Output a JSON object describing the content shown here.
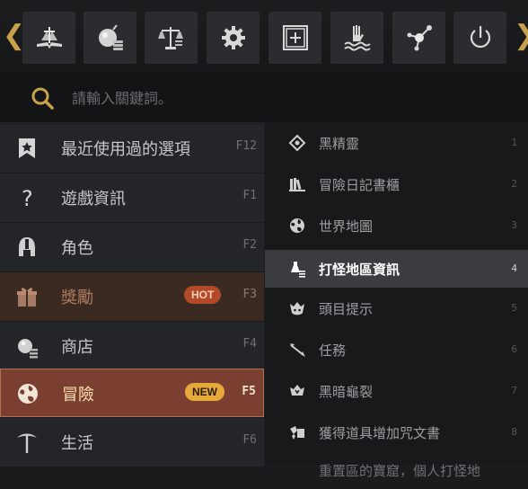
{
  "toolbar": {
    "prev_arrow": "❮",
    "next_arrow": "❯",
    "buttons": [
      {
        "name": "guide-book-icon"
      },
      {
        "name": "shop-coin-icon"
      },
      {
        "name": "balance-scale-icon"
      },
      {
        "name": "gear-icon"
      },
      {
        "name": "add-window-icon"
      },
      {
        "name": "hand-water-icon"
      },
      {
        "name": "network-nodes-icon"
      },
      {
        "name": "power-icon"
      }
    ]
  },
  "search": {
    "placeholder": "請輸入關鍵詞。"
  },
  "left_menu": {
    "items": [
      {
        "label": "最近使用過的選項",
        "key": "F12",
        "icon": "bookmark-star-icon"
      },
      {
        "label": "遊戲資訊",
        "key": "F1",
        "icon": "question-mark-icon"
      },
      {
        "label": "角色",
        "key": "F2",
        "icon": "helmet-icon"
      },
      {
        "label": "獎勵",
        "key": "F3",
        "icon": "gift-box-icon",
        "badge": "HOT"
      },
      {
        "label": "商店",
        "key": "F4",
        "icon": "shop-coin-icon"
      },
      {
        "label": "冒險",
        "key": "F5",
        "icon": "globe-icon",
        "badge": "NEW",
        "active": true
      },
      {
        "label": "生活",
        "key": "F6",
        "icon": "pickaxe-icon"
      }
    ]
  },
  "right_menu": {
    "items": [
      {
        "label": "黑精靈",
        "num": "1",
        "icon": "diamond-eye-icon"
      },
      {
        "label": "冒險日記書櫃",
        "num": "2",
        "icon": "bookshelf-icon"
      },
      {
        "label": "世界地圖",
        "num": "3",
        "icon": "globe-icon"
      },
      {
        "label": "打怪地區資訊",
        "num": "4",
        "icon": "hunting-info-icon",
        "selected": true
      },
      {
        "label": "頭目提示",
        "num": "5",
        "icon": "boss-head-icon"
      },
      {
        "label": "任務",
        "num": "6",
        "icon": "quest-arrow-icon"
      },
      {
        "label": "黑暗龜裂",
        "num": "7",
        "icon": "dark-rift-icon"
      },
      {
        "label": "獲得道具增加咒文書",
        "num": "8",
        "icon": "item-scroll-icon"
      },
      {
        "label": "重置區的寶窟，個人打怪地",
        "num": "",
        "icon": ""
      }
    ]
  },
  "colors": {
    "accent_gold": "#c8a14a",
    "active_bg": "#7a3f31",
    "hot_badge": "#b24a2a",
    "new_badge": "#e7a93a"
  }
}
